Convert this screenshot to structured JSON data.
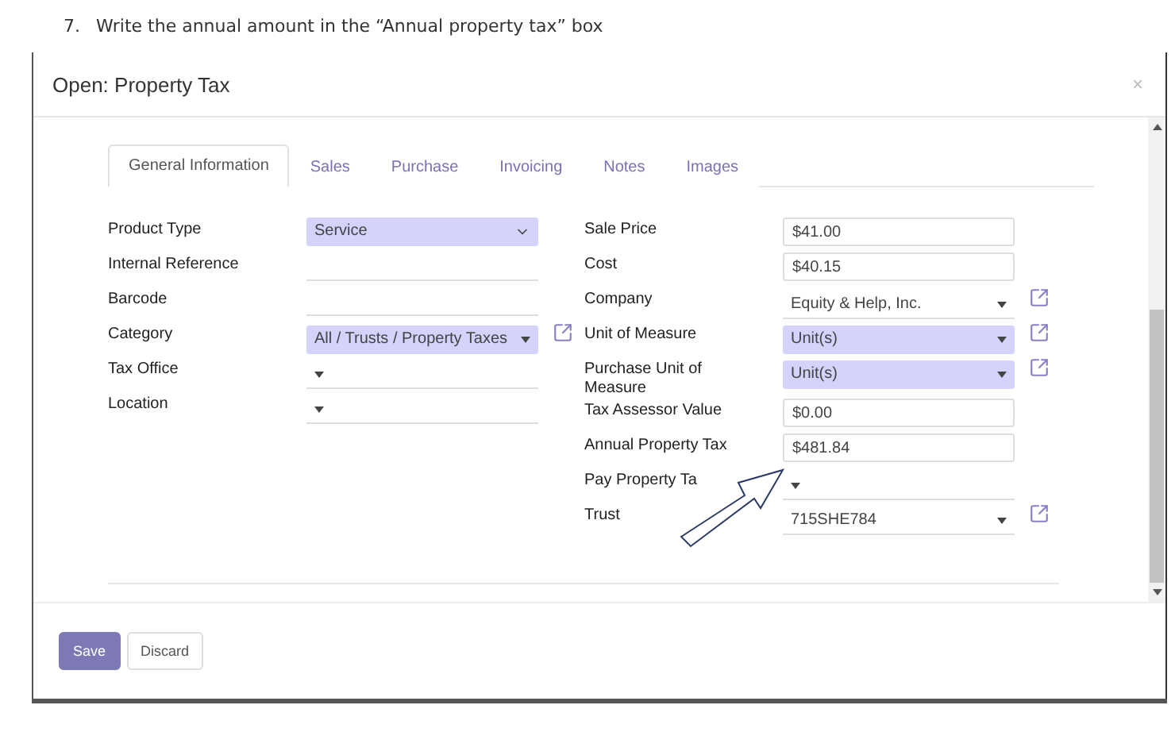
{
  "instruction": {
    "number": "7.",
    "text": "Write the annual amount in the “Annual property tax” box"
  },
  "dialog": {
    "title": "Open: Property Tax",
    "close": "×"
  },
  "tabs": [
    {
      "label": "General Information",
      "selected": true
    },
    {
      "label": "Sales",
      "selected": false
    },
    {
      "label": "Purchase",
      "selected": false
    },
    {
      "label": "Invoicing",
      "selected": false
    },
    {
      "label": "Notes",
      "selected": false
    },
    {
      "label": "Images",
      "selected": false
    }
  ],
  "left_fields": [
    {
      "label": "Product Type",
      "kind": "select",
      "value": "Service",
      "required": true,
      "link": false
    },
    {
      "label": "Internal Reference",
      "kind": "text",
      "required": false,
      "link": false
    },
    {
      "label": "Barcode",
      "kind": "text",
      "required": false,
      "link": false
    },
    {
      "label": "Category",
      "kind": "dropdown",
      "value": "All / Trusts / Property Taxes",
      "required": true,
      "link": true
    },
    {
      "label": "Tax Office",
      "kind": "dropdown",
      "required": false,
      "link": false
    },
    {
      "label": "Location",
      "kind": "dropdown",
      "required": false,
      "link": false
    }
  ],
  "right_fields": [
    {
      "label": "Sale Price",
      "kind": "box",
      "value": "$41.00",
      "required": false,
      "link": false
    },
    {
      "label": "Cost",
      "kind": "box",
      "value": "$40.15",
      "required": false,
      "link": false
    },
    {
      "label": "Company",
      "kind": "dropdown",
      "value": "Equity & Help, Inc.",
      "required": false,
      "link": true
    },
    {
      "label": "Unit of Measure",
      "kind": "dropdown",
      "value": "Unit(s)",
      "required": true,
      "link": true
    },
    {
      "label": "Purchase Unit of Measure",
      "kind": "dropdown",
      "value": "Unit(s)",
      "required": true,
      "link": true
    },
    {
      "label": "Tax Assessor Value",
      "kind": "box",
      "value": "$0.00",
      "required": false,
      "link": false
    },
    {
      "label": "Annual Property Tax",
      "kind": "box",
      "value": "$481.84",
      "required": false,
      "link": false
    },
    {
      "label": "Pay Property Ta",
      "kind": "dropdown",
      "required": false,
      "link": false
    },
    {
      "label": "Trust",
      "kind": "dropdown",
      "value": "715SHE784",
      "required": false,
      "link": true
    }
  ],
  "buttons": [
    {
      "label": "Save",
      "kind": "primary"
    },
    {
      "label": "Discard",
      "kind": "secondary"
    }
  ]
}
